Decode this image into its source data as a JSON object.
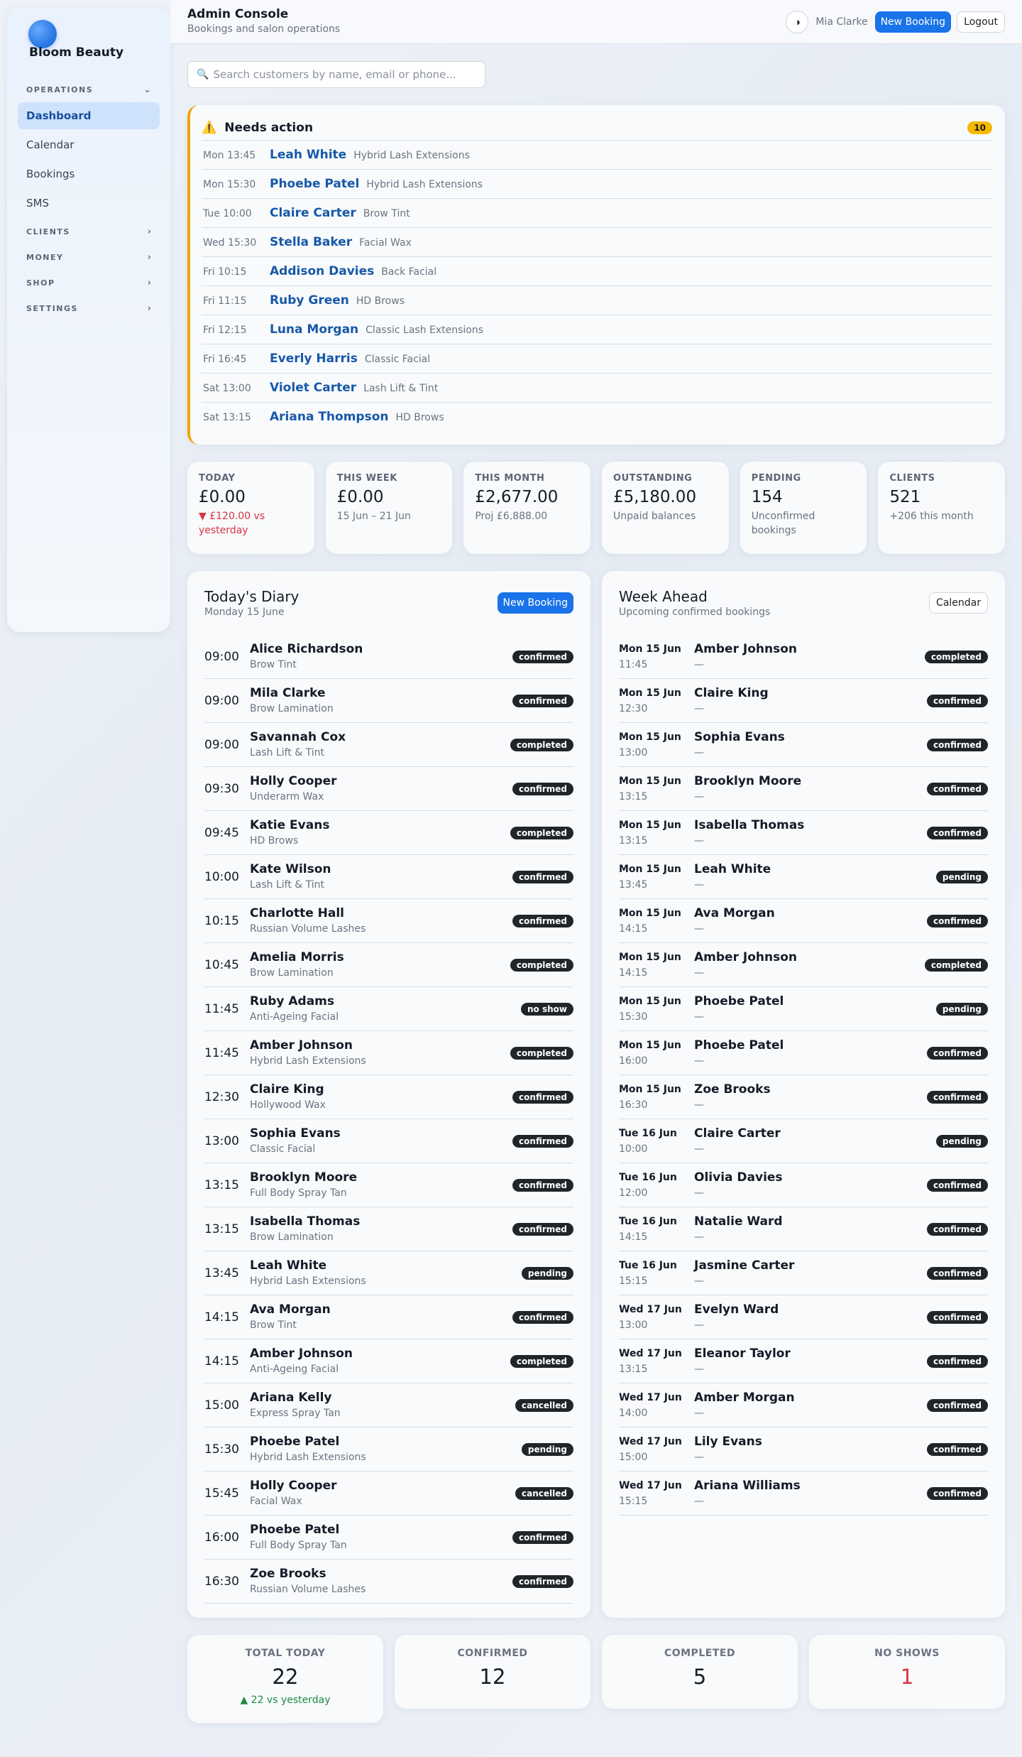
{
  "sidebar": {
    "brand": "Bloom Beauty",
    "sections": [
      {
        "label": "OPERATIONS",
        "chevron": "⌄",
        "expanded": true,
        "items": [
          {
            "label": "Dashboard",
            "active": true
          },
          {
            "label": "Calendar",
            "active": false
          },
          {
            "label": "Bookings",
            "active": false
          },
          {
            "label": "SMS",
            "active": false
          }
        ]
      },
      {
        "label": "CLIENTS",
        "chevron": "›",
        "expanded": false
      },
      {
        "label": "MONEY",
        "chevron": "›",
        "expanded": false
      },
      {
        "label": "SHOP",
        "chevron": "›",
        "expanded": false
      },
      {
        "label": "SETTINGS",
        "chevron": "›",
        "expanded": false
      }
    ]
  },
  "header": {
    "title": "Admin Console",
    "subtitle": "Bookings and salon operations",
    "theme_icon": "◑",
    "user": "Mia Clarke",
    "new_booking": "New Booking",
    "logout": "Logout"
  },
  "search": {
    "icon": "🔍",
    "placeholder": "Search customers by name, email or phone..."
  },
  "needs_action": {
    "icon": "⚠️",
    "title": "Needs action",
    "count": "10",
    "accent": "#f0a300",
    "items": [
      {
        "time": "Mon 13:45",
        "name": "Leah White",
        "service": "Hybrid Lash Extensions"
      },
      {
        "time": "Mon 15:30",
        "name": "Phoebe Patel",
        "service": "Hybrid Lash Extensions"
      },
      {
        "time": "Tue 10:00",
        "name": "Claire Carter",
        "service": "Brow Tint"
      },
      {
        "time": "Wed 15:30",
        "name": "Stella Baker",
        "service": "Facial Wax"
      },
      {
        "time": "Fri 10:15",
        "name": "Addison Davies",
        "service": "Back Facial"
      },
      {
        "time": "Fri 11:15",
        "name": "Ruby Green",
        "service": "HD Brows"
      },
      {
        "time": "Fri 12:15",
        "name": "Luna Morgan",
        "service": "Classic Lash Extensions"
      },
      {
        "time": "Fri 16:45",
        "name": "Everly Harris",
        "service": "Classic Facial"
      },
      {
        "time": "Sat 13:00",
        "name": "Violet Carter",
        "service": "Lash Lift & Tint"
      },
      {
        "time": "Sat 13:15",
        "name": "Ariana Thompson",
        "service": "HD Brows"
      }
    ]
  },
  "stats": [
    {
      "label": "TODAY",
      "value": "£0.00",
      "sub": "▼ £120.00 vs yesterday",
      "trend": "down"
    },
    {
      "label": "THIS WEEK",
      "value": "£0.00",
      "sub": "15 Jun – 21 Jun",
      "trend": ""
    },
    {
      "label": "THIS MONTH",
      "value": "£2,677.00",
      "sub": "Proj £6,888.00",
      "trend": ""
    },
    {
      "label": "OUTSTANDING",
      "value": "£5,180.00",
      "sub": "Unpaid balances",
      "trend": ""
    },
    {
      "label": "PENDING",
      "value": "154",
      "sub": "Unconfirmed bookings",
      "trend": ""
    },
    {
      "label": "CLIENTS",
      "value": "521",
      "sub": "+206 this month",
      "trend": ""
    }
  ],
  "diary": {
    "title": "Today's Diary",
    "date": "Monday 15 June",
    "button": "New Booking",
    "rows": [
      {
        "time": "09:00",
        "name": "Alice Richardson",
        "service": "Brow Tint",
        "status": "confirmed"
      },
      {
        "time": "09:00",
        "name": "Mila Clarke",
        "service": "Brow Lamination",
        "status": "confirmed"
      },
      {
        "time": "09:00",
        "name": "Savannah Cox",
        "service": "Lash Lift & Tint",
        "status": "completed"
      },
      {
        "time": "09:30",
        "name": "Holly Cooper",
        "service": "Underarm Wax",
        "status": "confirmed"
      },
      {
        "time": "09:45",
        "name": "Katie Evans",
        "service": "HD Brows",
        "status": "completed"
      },
      {
        "time": "10:00",
        "name": "Kate Wilson",
        "service": "Lash Lift & Tint",
        "status": "confirmed"
      },
      {
        "time": "10:15",
        "name": "Charlotte Hall",
        "service": "Russian Volume Lashes",
        "status": "confirmed"
      },
      {
        "time": "10:45",
        "name": "Amelia Morris",
        "service": "Brow Lamination",
        "status": "completed"
      },
      {
        "time": "11:45",
        "name": "Ruby Adams",
        "service": "Anti-Ageing Facial",
        "status": "no show"
      },
      {
        "time": "11:45",
        "name": "Amber Johnson",
        "service": "Hybrid Lash Extensions",
        "status": "completed"
      },
      {
        "time": "12:30",
        "name": "Claire King",
        "service": "Hollywood Wax",
        "status": "confirmed"
      },
      {
        "time": "13:00",
        "name": "Sophia Evans",
        "service": "Classic Facial",
        "status": "confirmed"
      },
      {
        "time": "13:15",
        "name": "Brooklyn Moore",
        "service": "Full Body Spray Tan",
        "status": "confirmed"
      },
      {
        "time": "13:15",
        "name": "Isabella Thomas",
        "service": "Brow Lamination",
        "status": "confirmed"
      },
      {
        "time": "13:45",
        "name": "Leah White",
        "service": "Hybrid Lash Extensions",
        "status": "pending"
      },
      {
        "time": "14:15",
        "name": "Ava Morgan",
        "service": "Brow Tint",
        "status": "confirmed"
      },
      {
        "time": "14:15",
        "name": "Amber Johnson",
        "service": "Anti-Ageing Facial",
        "status": "completed"
      },
      {
        "time": "15:00",
        "name": "Ariana Kelly",
        "service": "Express Spray Tan",
        "status": "cancelled"
      },
      {
        "time": "15:30",
        "name": "Phoebe Patel",
        "service": "Hybrid Lash Extensions",
        "status": "pending"
      },
      {
        "time": "15:45",
        "name": "Holly Cooper",
        "service": "Facial Wax",
        "status": "cancelled"
      },
      {
        "time": "16:00",
        "name": "Phoebe Patel",
        "service": "Full Body Spray Tan",
        "status": "confirmed"
      },
      {
        "time": "16:30",
        "name": "Zoe Brooks",
        "service": "Russian Volume Lashes",
        "status": "confirmed"
      }
    ]
  },
  "week": {
    "title": "Week Ahead",
    "subtitle": "Upcoming confirmed bookings",
    "button": "Calendar",
    "rows": [
      {
        "day": "Mon 15 Jun",
        "time": "11:45",
        "name": "Amber Johnson",
        "service": "—",
        "status": "completed"
      },
      {
        "day": "Mon 15 Jun",
        "time": "12:30",
        "name": "Claire King",
        "service": "—",
        "status": "confirmed"
      },
      {
        "day": "Mon 15 Jun",
        "time": "13:00",
        "name": "Sophia Evans",
        "service": "—",
        "status": "confirmed"
      },
      {
        "day": "Mon 15 Jun",
        "time": "13:15",
        "name": "Brooklyn Moore",
        "service": "—",
        "status": "confirmed"
      },
      {
        "day": "Mon 15 Jun",
        "time": "13:15",
        "name": "Isabella Thomas",
        "service": "—",
        "status": "confirmed"
      },
      {
        "day": "Mon 15 Jun",
        "time": "13:45",
        "name": "Leah White",
        "service": "—",
        "status": "pending"
      },
      {
        "day": "Mon 15 Jun",
        "time": "14:15",
        "name": "Ava Morgan",
        "service": "—",
        "status": "confirmed"
      },
      {
        "day": "Mon 15 Jun",
        "time": "14:15",
        "name": "Amber Johnson",
        "service": "—",
        "status": "completed"
      },
      {
        "day": "Mon 15 Jun",
        "time": "15:30",
        "name": "Phoebe Patel",
        "service": "—",
        "status": "pending"
      },
      {
        "day": "Mon 15 Jun",
        "time": "16:00",
        "name": "Phoebe Patel",
        "service": "—",
        "status": "confirmed"
      },
      {
        "day": "Mon 15 Jun",
        "time": "16:30",
        "name": "Zoe Brooks",
        "service": "—",
        "status": "confirmed"
      },
      {
        "day": "Tue 16 Jun",
        "time": "10:00",
        "name": "Claire Carter",
        "service": "—",
        "status": "pending"
      },
      {
        "day": "Tue 16 Jun",
        "time": "12:00",
        "name": "Olivia Davies",
        "service": "—",
        "status": "confirmed"
      },
      {
        "day": "Tue 16 Jun",
        "time": "14:15",
        "name": "Natalie Ward",
        "service": "—",
        "status": "confirmed"
      },
      {
        "day": "Tue 16 Jun",
        "time": "15:15",
        "name": "Jasmine Carter",
        "service": "—",
        "status": "confirmed"
      },
      {
        "day": "Wed 17 Jun",
        "time": "13:00",
        "name": "Evelyn Ward",
        "service": "—",
        "status": "confirmed"
      },
      {
        "day": "Wed 17 Jun",
        "time": "13:15",
        "name": "Eleanor Taylor",
        "service": "—",
        "status": "confirmed"
      },
      {
        "day": "Wed 17 Jun",
        "time": "14:00",
        "name": "Amber Morgan",
        "service": "—",
        "status": "confirmed"
      },
      {
        "day": "Wed 17 Jun",
        "time": "15:00",
        "name": "Lily Evans",
        "service": "—",
        "status": "confirmed"
      },
      {
        "day": "Wed 17 Jun",
        "time": "15:15",
        "name": "Ariana Williams",
        "service": "—",
        "status": "confirmed"
      }
    ]
  },
  "summary": [
    {
      "label": "TOTAL TODAY",
      "value": "22",
      "sub": "▲ 22 vs yesterday"
    },
    {
      "label": "CONFIRMED",
      "value": "12",
      "sub": ""
    },
    {
      "label": "COMPLETED",
      "value": "5",
      "sub": ""
    },
    {
      "label": "NO SHOWS",
      "value": "1",
      "sub": "",
      "highlight": "red"
    }
  ],
  "colors": {
    "accent": "#1a73e8",
    "warning": "#f0a300",
    "badge": "#212529",
    "negative": "#d9333f",
    "positive": "#1e8a3e"
  }
}
